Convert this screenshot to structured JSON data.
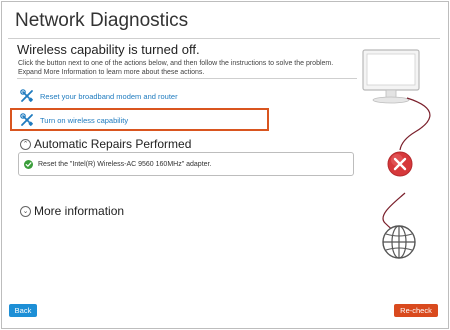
{
  "app": {
    "title": "Network Diagnostics"
  },
  "problem": {
    "heading": "Wireless capability is turned off.",
    "description_lines": [
      "Click the button next to one of the actions below, and then follow the instructions to solve the problem.",
      "Expand More Information to learn more about these actions."
    ]
  },
  "actions": [
    {
      "label": "Reset your broadband modem and router",
      "icon": "wrench-icon"
    },
    {
      "label": "Turn on wireless capability",
      "icon": "wrench-icon",
      "highlighted": true
    }
  ],
  "repairs": {
    "title": "Automatic Repairs Performed",
    "expanded": true,
    "items": [
      {
        "text": "Reset the \"Intel(R) Wireless-AC 9560 160MHz\" adapter.",
        "status_icon": "check-circle-icon"
      }
    ]
  },
  "more_info": {
    "title": "More information",
    "expanded": false
  },
  "diagram": {
    "nodes": [
      "computer-monitor-icon",
      "error-x-icon",
      "globe-icon"
    ]
  },
  "buttons": {
    "back": "Back",
    "recheck": "Re-check"
  },
  "colors": {
    "link": "#1f7bbf",
    "highlight_border": "#d9551f",
    "back_button": "#1d8fd6",
    "recheck_button": "#d94a1e",
    "error_red": "#d6383b",
    "cable": "#7a1f2b",
    "success_green": "#3b9e3b"
  }
}
